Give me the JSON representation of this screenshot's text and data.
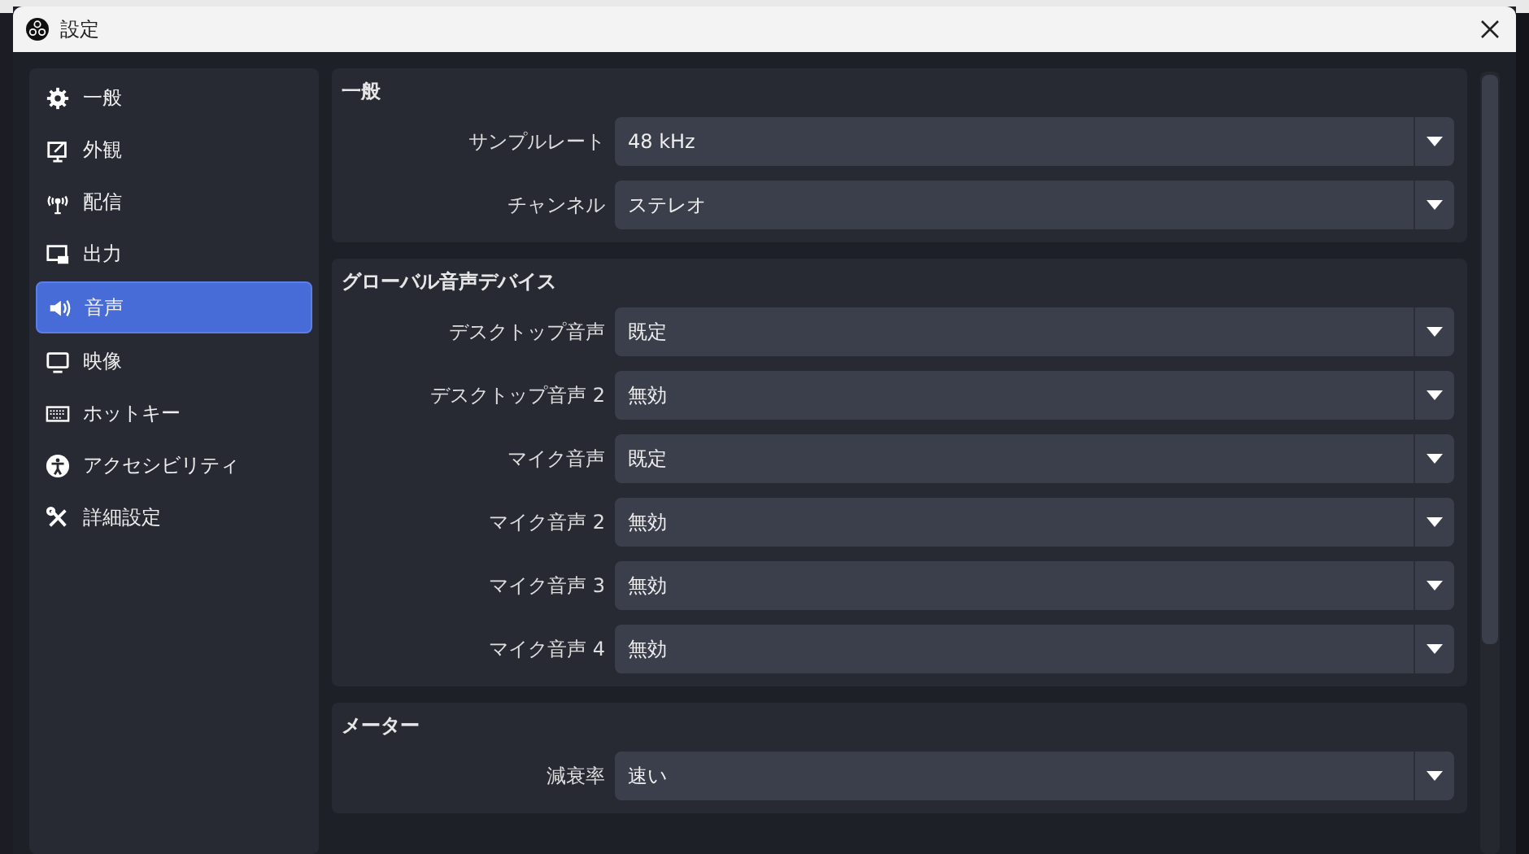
{
  "window": {
    "title": "設定"
  },
  "sidebar": {
    "items": [
      {
        "label": "一般",
        "kind": "gear",
        "selected": false
      },
      {
        "label": "外観",
        "kind": "appearance",
        "selected": false
      },
      {
        "label": "配信",
        "kind": "antenna",
        "selected": false
      },
      {
        "label": "出力",
        "kind": "output",
        "selected": false
      },
      {
        "label": "音声",
        "kind": "speaker",
        "selected": true
      },
      {
        "label": "映像",
        "kind": "monitor",
        "selected": false
      },
      {
        "label": "ホットキー",
        "kind": "keyboard",
        "selected": false
      },
      {
        "label": "アクセシビリティ",
        "kind": "accessibility",
        "selected": false
      },
      {
        "label": "詳細設定",
        "kind": "tools",
        "selected": false
      }
    ]
  },
  "sections": [
    {
      "title": "一般",
      "rows": [
        {
          "label": "サンプルレート",
          "value": "48 kHz"
        },
        {
          "label": "チャンネル",
          "value": "ステレオ"
        }
      ]
    },
    {
      "title": "グローバル音声デバイス",
      "rows": [
        {
          "label": "デスクトップ音声",
          "value": "既定"
        },
        {
          "label": "デスクトップ音声 2",
          "value": "無効"
        },
        {
          "label": "マイク音声",
          "value": "既定"
        },
        {
          "label": "マイク音声 2",
          "value": "無効"
        },
        {
          "label": "マイク音声 3",
          "value": "無効"
        },
        {
          "label": "マイク音声 4",
          "value": "無効"
        }
      ]
    },
    {
      "title": "メーター",
      "rows": [
        {
          "label": "減衰率",
          "value": "速い"
        }
      ]
    }
  ]
}
